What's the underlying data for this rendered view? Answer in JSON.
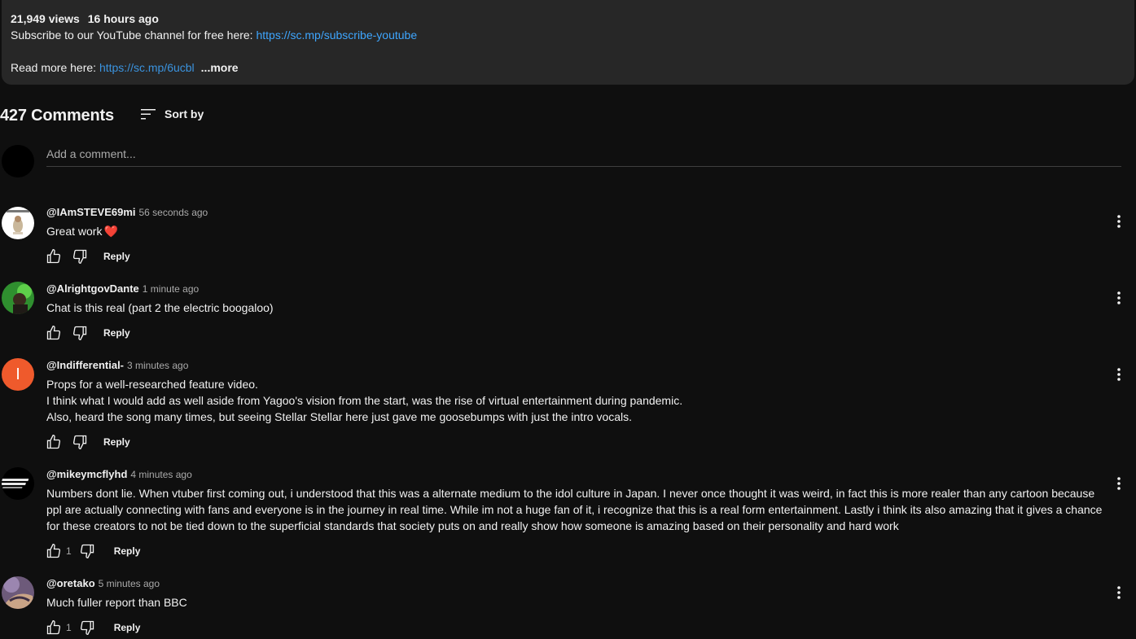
{
  "description": {
    "views": "21,949 views",
    "age": "16 hours ago",
    "line1_prefix": "Subscribe to our YouTube channel for free here: ",
    "line1_link": "https://sc.mp/subscribe-youtube",
    "line2_prefix": "Read more here: ",
    "line2_link": "https://sc.mp/6ucbl",
    "more_label": "...more"
  },
  "comments_header": {
    "count": "427 Comments",
    "sort_label": "Sort by"
  },
  "add_comment": {
    "placeholder": "Add a comment..."
  },
  "colors": {
    "link": "#3ea6ff",
    "bg": "#0f0f0f",
    "panel": "#272727",
    "avatar_orange": "#ef5a2c"
  },
  "comments": [
    {
      "author": "@IAmSTEVE69mi",
      "time": "56 seconds ago",
      "text": "Great work",
      "emoji": "❤️",
      "likes": "",
      "reply_label": "Reply"
    },
    {
      "author": "@AlrightgovDante",
      "time": "1 minute ago",
      "text": "Chat is this real (part 2 the electric boogaloo)",
      "likes": "",
      "reply_label": "Reply"
    },
    {
      "author": "@Indifferential-",
      "time": "3 minutes ago",
      "avatar_letter": "I",
      "text_lines": [
        "Props for a well-researched feature video.",
        "I think what I would add as well aside from Yagoo's vision from the start, was the rise of virtual entertainment during pandemic.",
        "Also, heard the song many times, but seeing Stellar Stellar here just gave me goosebumps with just the intro vocals."
      ],
      "likes": "",
      "reply_label": "Reply"
    },
    {
      "author": "@mikeymcflyhd",
      "time": "4 minutes ago",
      "text": "Numbers dont lie. When vtuber first coming out, i understood that  this was a alternate medium to the idol culture in Japan. I never once thought it was weird, in fact this is more realer than any cartoon because ppl are actually connecting with fans and everyone is in the journey in real time. While im not a huge fan of it, i recognize that this is a real form entertainment. Lastly i think its also amazing that it gives a chance for these creators to not be tied down to the superficial standards that society puts on and really show how someone is amazing based on their personality and hard work",
      "likes": "1",
      "reply_label": "Reply"
    },
    {
      "author": "@oretako",
      "time": "5 minutes ago",
      "text": "Much fuller report than BBC",
      "likes": "1",
      "reply_label": "Reply"
    }
  ]
}
